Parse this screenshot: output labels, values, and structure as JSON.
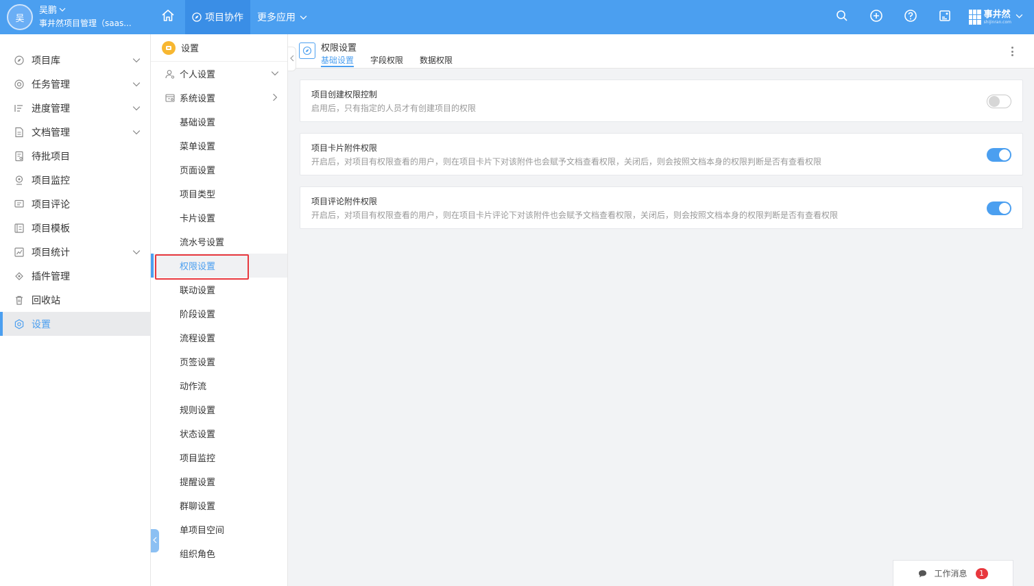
{
  "topbar": {
    "avatar_text": "吴",
    "user_name": "吴鹏",
    "user_org": "事井然项目管理（saas...",
    "tabs": [
      {
        "label": "项目协作",
        "active": true
      },
      {
        "label": "更多应用",
        "active": false
      }
    ],
    "right_icons": [
      "search-icon",
      "add-circle-icon",
      "help-icon",
      "profile-card-icon"
    ],
    "brand_name": "事井然",
    "brand_sub": "shijinran.com",
    "accent_color": "#4b9ff0"
  },
  "sidebar": {
    "items": [
      {
        "label": "项目库",
        "icon": "project-library-icon",
        "has_chevron": true
      },
      {
        "label": "任务管理",
        "icon": "task-icon",
        "has_chevron": true
      },
      {
        "label": "进度管理",
        "icon": "progress-icon",
        "has_chevron": true
      },
      {
        "label": "文档管理",
        "icon": "document-icon",
        "has_chevron": true
      },
      {
        "label": "待批项目",
        "icon": "pending-icon",
        "has_chevron": false
      },
      {
        "label": "项目监控",
        "icon": "monitor-icon",
        "has_chevron": false
      },
      {
        "label": "项目评论",
        "icon": "comment-icon",
        "has_chevron": false
      },
      {
        "label": "项目模板",
        "icon": "template-icon",
        "has_chevron": false
      },
      {
        "label": "项目统计",
        "icon": "statistics-icon",
        "has_chevron": true
      },
      {
        "label": "插件管理",
        "icon": "plugin-icon",
        "has_chevron": false
      },
      {
        "label": "回收站",
        "icon": "trash-icon",
        "has_chevron": false
      },
      {
        "label": "设置",
        "icon": "settings-icon",
        "has_chevron": false,
        "active": true
      }
    ]
  },
  "submenu": {
    "header": "设置",
    "groups": [
      {
        "label": "个人设置",
        "chevron": "down"
      },
      {
        "label": "系统设置",
        "chevron": "right"
      }
    ],
    "items": [
      "基础设置",
      "菜单设置",
      "页面设置",
      "项目类型",
      "卡片设置",
      "流水号设置",
      "权限设置",
      "联动设置",
      "阶段设置",
      "流程设置",
      "页签设置",
      "动作流",
      "规则设置",
      "状态设置",
      "项目监控",
      "提醒设置",
      "群聊设置",
      "单项目空间",
      "组织角色"
    ],
    "active_item": "权限设置"
  },
  "main": {
    "title": "权限设置",
    "tabs": [
      {
        "label": "基础设置",
        "active": true
      },
      {
        "label": "字段权限",
        "active": false
      },
      {
        "label": "数据权限",
        "active": false
      }
    ],
    "settings": [
      {
        "title": "项目创建权限控制",
        "desc": "启用后，只有指定的人员才有创建项目的权限",
        "enabled": false
      },
      {
        "title": "项目卡片附件权限",
        "desc": "开启后，对项目有权限查看的用户，则在项目卡片下对该附件也会赋予文档查看权限，关闭后，则会按照文档本身的权限判断是否有查看权限",
        "enabled": true
      },
      {
        "title": "项目评论附件权限",
        "desc": "开启后，对项目有权限查看的用户，则在项目卡片评论下对该附件也会赋予文档查看权限，关闭后，则会按照文档本身的权限判断是否有查看权限",
        "enabled": true
      }
    ]
  },
  "message_button": {
    "label": "工作消息",
    "badge": "1"
  }
}
